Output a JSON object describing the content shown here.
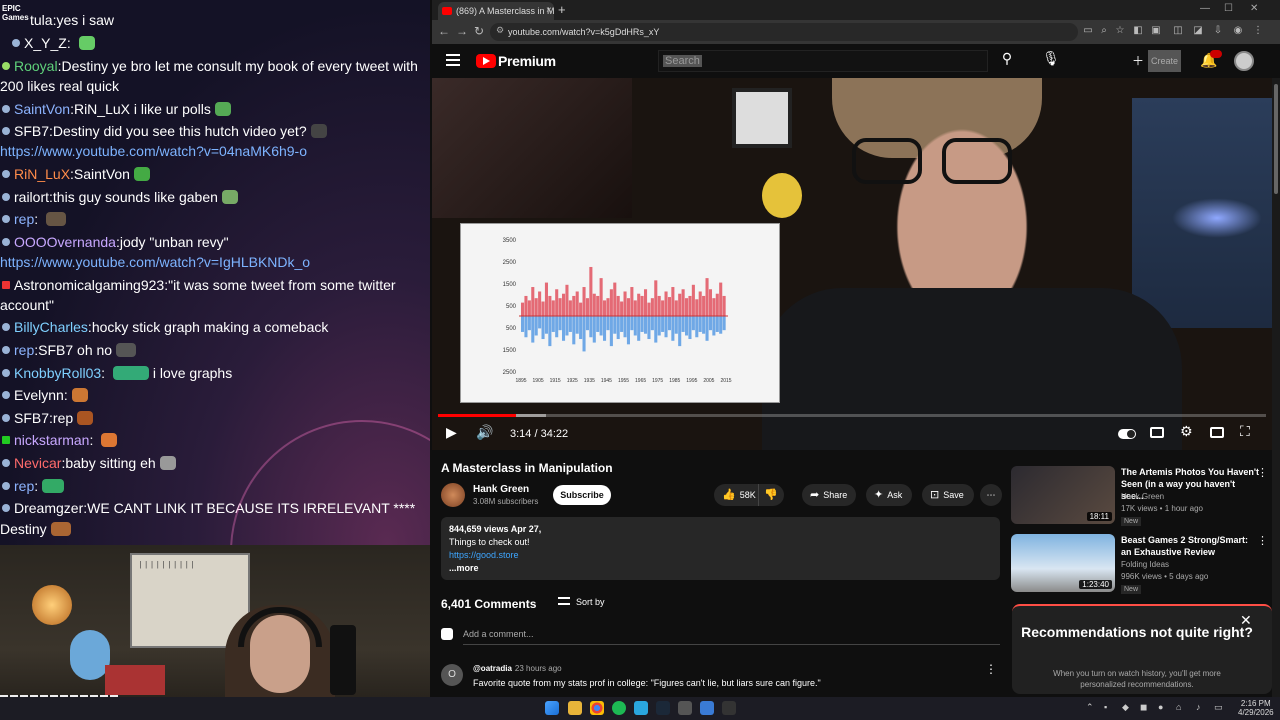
{
  "chat": {
    "brand": "EPIC Games",
    "lines": [
      {
        "user": "tula",
        "text": "yes i saw"
      },
      {
        "user": "X_Y_Z",
        "text": ""
      },
      {
        "user": "Rooyal",
        "text": "Destiny ye bro let me consult my book of every tweet with"
      },
      {
        "user": "",
        "text": "200 likes real quick"
      },
      {
        "user": "SaintVon",
        "text": "RiN_LuX i like ur polls"
      },
      {
        "user": "SFB7",
        "text": "Destiny did you see this hutch video yet?"
      },
      {
        "user": "",
        "text": "https://www.youtube.com/watch?v=04naMK6h9-o"
      },
      {
        "user": "RiN_LuX",
        "text": "SaintVon"
      },
      {
        "user": "railort",
        "text": "this guy sounds like gaben"
      },
      {
        "user": "rep",
        "text": ""
      },
      {
        "user": "OOOOvernanda",
        "text": "jody \"unban revy\""
      },
      {
        "user": "",
        "text": "https://www.youtube.com/watch?v=IgHLBKNDk_o"
      },
      {
        "user": "Astronomicalgaming923",
        "text": "\"it was some tweet from some twitter"
      },
      {
        "user": "",
        "text": "account\""
      },
      {
        "user": "BillyCharles",
        "text": "hocky stick graph making a comeback"
      },
      {
        "user": "rep",
        "text": "SFB7 oh no"
      },
      {
        "user": "KnobbyRoll03",
        "text": "i love graphs"
      },
      {
        "user": "Evelynn",
        "text": ""
      },
      {
        "user": "SFB7",
        "text": "rep"
      },
      {
        "user": "nickstarman",
        "text": ""
      },
      {
        "user": "Nevicar",
        "text": "baby sitting eh"
      },
      {
        "user": "rep",
        "text": ""
      },
      {
        "user": "Dreamgzer",
        "text": "WE CANT LINK IT BECAUSE ITS IRRELEVANT ****"
      },
      {
        "user": "",
        "text": "Destiny"
      }
    ]
  },
  "browser": {
    "tab_title": "(869) A Masterclass in Manipulati...",
    "url": "youtube.com/watch?v=k5gDdHRs_xY"
  },
  "youtube": {
    "brand": "Premium",
    "search_placeholder": "Search",
    "create_label": "Create",
    "video": {
      "title": "A Masterclass in Manipulation",
      "time": "3:14 / 34:22",
      "progress": 0.094,
      "buffered": 0.13
    },
    "channel": {
      "name": "Hank Green",
      "subs": "3.08M subscribers"
    },
    "subscribe": "Subscribe",
    "actions": {
      "likes": "58K",
      "share": "Share",
      "ask": "Ask",
      "save": "Save"
    },
    "description": {
      "views_date": "844,659 views  Apr 27,",
      "line1": "Things to check out!",
      "link": "https://good.store",
      "more": "...more"
    },
    "comments": {
      "count": "6,401 Comments",
      "sort": "Sort by",
      "add_placeholder": "Add a comment...",
      "first": {
        "initial": "O",
        "author": "@oatradia",
        "time": "23 hours ago",
        "text": "Favorite quote from my stats prof in college: \"Figures can't lie, but liars sure can figure.\""
      }
    },
    "recommendations": [
      {
        "title": "The Artemis Photos You Haven't Seen (in a way you haven't see...",
        "channel": "Hank Green",
        "meta": "17K views • 1 hour ago",
        "badge": "New",
        "duration": "18:11"
      },
      {
        "title": "Beast Games 2 Strong/Smart: an Exhaustive Review",
        "channel": "Folding Ideas",
        "meta": "996K views • 5 days ago",
        "badge": "New",
        "duration": "1:23:40"
      }
    ],
    "not_right": {
      "title": "Recommendations not quite right?",
      "text": "When you turn on watch history, you'll get more personalized recommendations."
    }
  },
  "clock": {
    "time": "2:16 PM",
    "date": "4/29/2026"
  },
  "chart_data": {
    "type": "bar",
    "title": "",
    "ytick_labels": [
      "3500",
      "2500",
      "1500",
      "500",
      "500",
      "1500",
      "2500"
    ],
    "xtick_labels": [
      "1895",
      "1905",
      "1915",
      "1925",
      "1935",
      "1945",
      "1955",
      "1965",
      "1975",
      "1985",
      "1995",
      "2005",
      "2015"
    ],
    "series": [
      {
        "color": "#e46a75",
        "values": [
          600,
          900,
          700,
          1300,
          800,
          1100,
          650,
          1500,
          900,
          700,
          1200,
          800,
          1000,
          1400,
          700,
          900,
          1100,
          600,
          1300,
          800,
          2200,
          1000,
          900,
          1700,
          700,
          800,
          1200,
          1500,
          900,
          650,
          1100,
          800,
          1300,
          700,
          1000,
          900,
          1200,
          600,
          800,
          1600,
          900,
          700,
          1100,
          850,
          1300,
          700,
          1000,
          1200,
          800,
          900,
          1400,
          750,
          1100,
          900,
          1700,
          1200,
          800,
          1000,
          1500,
          900
        ]
      },
      {
        "color": "#6fa8e6",
        "values": [
          900,
          1200,
          800,
          1500,
          1100,
          700,
          1300,
          1000,
          1700,
          900,
          1200,
          800,
          1400,
          1100,
          900,
          1600,
          1000,
          1300,
          2000,
          800,
          1200,
          1500,
          900,
          1100,
          1400,
          800,
          1700,
          1000,
          1300,
          900,
          1200,
          1600,
          800,
          1100,
          1400,
          900,
          1000,
          1300,
          800,
          1500,
          1100,
          900,
          1200,
          800,
          1400,
          1000,
          1700,
          900,
          1100,
          1300,
          800,
          1200,
          900,
          1000,
          1400,
          800,
          1100,
          900,
          1000,
          800
        ]
      }
    ]
  }
}
